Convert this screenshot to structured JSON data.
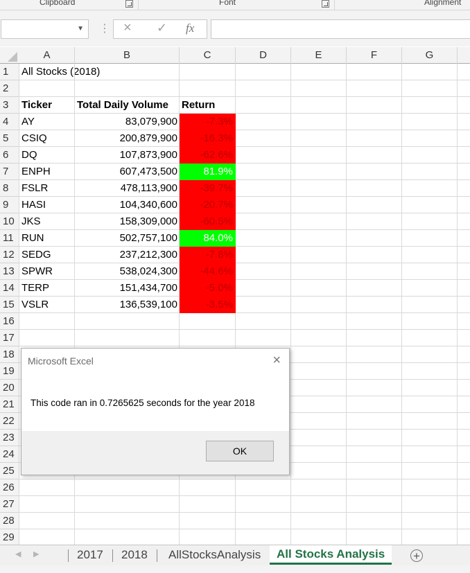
{
  "ribbon": {
    "groups": [
      "Clipboard",
      "Font",
      "Alignment"
    ]
  },
  "formula_bar": {
    "name_box": "",
    "formula": "",
    "cancel_icon": "×",
    "enter_icon": "✓",
    "fx_label": "fx"
  },
  "columns": [
    "A",
    "B",
    "C",
    "D",
    "E",
    "F",
    "G"
  ],
  "rows": [
    "1",
    "2",
    "3",
    "4",
    "5",
    "6",
    "7",
    "8",
    "9",
    "10",
    "11",
    "12",
    "13",
    "14",
    "15",
    "16",
    "17",
    "18",
    "19",
    "20",
    "21",
    "22",
    "23",
    "24",
    "25",
    "26",
    "27",
    "28",
    "29"
  ],
  "sheet": {
    "title": "All Stocks (2018)",
    "headers": {
      "ticker": "Ticker",
      "volume": "Total Daily Volume",
      "return": "Return"
    },
    "data": [
      {
        "ticker": "AY",
        "volume": "83,079,900",
        "return": "-7.3%"
      },
      {
        "ticker": "CSIQ",
        "volume": "200,879,900",
        "return": "-16.3%"
      },
      {
        "ticker": "DQ",
        "volume": "107,873,900",
        "return": "-62.6%"
      },
      {
        "ticker": "ENPH",
        "volume": "607,473,500",
        "return": "81.9%"
      },
      {
        "ticker": "FSLR",
        "volume": "478,113,900",
        "return": "-39.7%"
      },
      {
        "ticker": "HASI",
        "volume": "104,340,600",
        "return": "-20.7%"
      },
      {
        "ticker": "JKS",
        "volume": "158,309,000",
        "return": "-60.5%"
      },
      {
        "ticker": "RUN",
        "volume": "502,757,100",
        "return": "84.0%"
      },
      {
        "ticker": "SEDG",
        "volume": "237,212,300",
        "return": "-7.8%"
      },
      {
        "ticker": "SPWR",
        "volume": "538,024,300",
        "return": "-44.6%"
      },
      {
        "ticker": "TERP",
        "volume": "151,434,700",
        "return": "-5.0%"
      },
      {
        "ticker": "VSLR",
        "volume": "136,539,100",
        "return": "-3.5%"
      }
    ]
  },
  "colors": {
    "positive_fill": "#00ff00",
    "negative_fill": "#ff0000",
    "active_tab": "#217346"
  },
  "dialog": {
    "title": "Microsoft Excel",
    "message": "This code ran in 0.7265625 seconds for the year 2018",
    "ok_label": "OK",
    "close_icon": "×"
  },
  "tabs": {
    "sheets": [
      "2017",
      "2018",
      "AllStocksAnalysis",
      "All Stocks Analysis"
    ],
    "active": "All Stocks Analysis",
    "add_icon": "+"
  }
}
